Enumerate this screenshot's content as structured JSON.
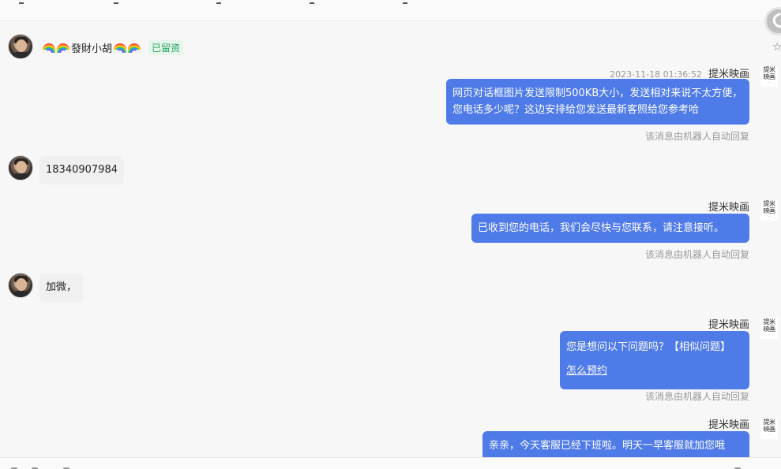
{
  "visitor": {
    "name": "發財小胡",
    "badge": "已留资",
    "messages": [
      "18340907984",
      "加微，"
    ]
  },
  "agent": {
    "name": "提米映画",
    "avatar_text_line1": "提米",
    "avatar_text_line2": "映画",
    "auto_reply_note": "该消息由机器人自动回复",
    "timestamp": "2023-11-18 01:36:52",
    "messages": {
      "m1": "网页对话框图片发送限制500KB大小，发送相对来说不太方便，您电话多少呢？这边安排给您发送最新客照给您参考哈",
      "m2": "已收到您的电话，我们会尽快与您联系，请注意接听。",
      "m3_text": "您是想问以下问题吗？【相似问题】",
      "m3_link": "怎么预约",
      "m4": "亲亲，今天客服已经下班啦。明天一早客服就加您哦"
    }
  },
  "icons": {
    "side_button": "phone-icon",
    "star": "star-icon",
    "rainbow": "rainbow-icon"
  },
  "colors": {
    "agent_bubble": "#4f7be8",
    "visitor_bubble": "#f0f0f0",
    "badge_green": "#24a25b",
    "background": "#f7f7f7"
  }
}
